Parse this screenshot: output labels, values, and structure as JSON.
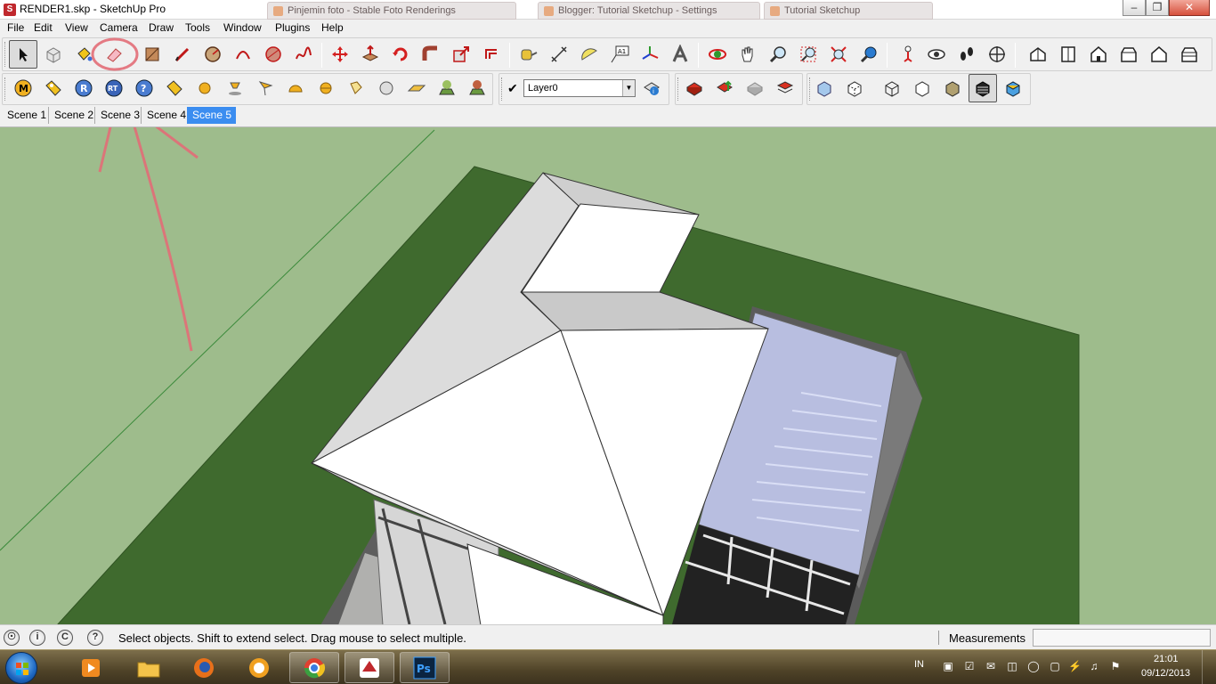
{
  "window": {
    "title": "RENDER1.skp - SketchUp Pro",
    "background_tabs": [
      "Pinjemin foto - Stable Foto Renderings",
      "Blogger: Tutorial Sketchup - Settings",
      "Tutorial Sketchup"
    ]
  },
  "menu": [
    "File",
    "Edit",
    "View",
    "Camera",
    "Draw",
    "Tools",
    "Window",
    "Plugins",
    "Help"
  ],
  "layers": {
    "current": "Layer0"
  },
  "scenes": [
    "Scene 1",
    "Scene 2",
    "Scene 3",
    "Scene 4",
    "Scene 5"
  ],
  "active_scene": "Scene 5",
  "status": {
    "hint": "Select objects. Shift to extend select. Drag mouse to select multiple.",
    "measurements_label": "Measurements",
    "measurements_value": ""
  },
  "taskbar": {
    "language": "IN",
    "time": "21:01",
    "date": "09/12/2013",
    "apps": [
      "windows-media-player",
      "windows-explorer",
      "firefox",
      "orb-app",
      "chrome",
      "sketchup",
      "photoshop"
    ]
  },
  "colors": {
    "sky": "#9ebc8c",
    "ground": "#3f6a2e",
    "roof": "#ffffff",
    "glass_roof": "#b8bee0",
    "annotation": "#e26d77",
    "active_tab": "#3b8df0"
  }
}
